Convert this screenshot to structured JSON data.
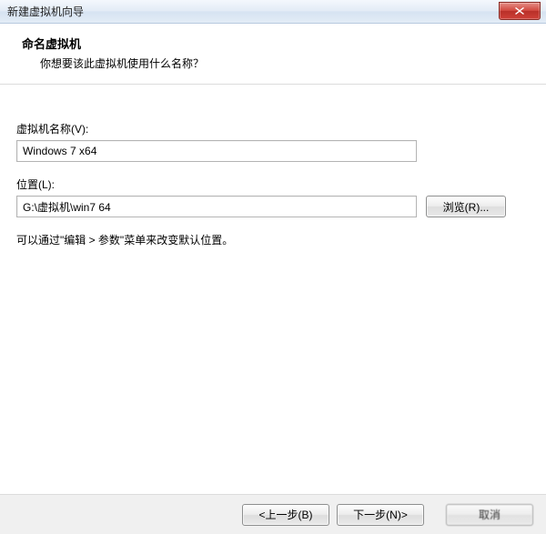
{
  "window": {
    "title": "新建虚拟机向导"
  },
  "header": {
    "title": "命名虚拟机",
    "subtitle": "你想要该此虚拟机使用什么名称？"
  },
  "vm_name": {
    "label": "虚拟机名称(V):",
    "value": "Windows 7 x64"
  },
  "location": {
    "label": "位置(L):",
    "value": "G:\\虚拟机\\win7 64",
    "browse_label": "浏览(R)..."
  },
  "hint": "可以通过\"编辑 > 参数\"菜单来改变默认位置。",
  "footer": {
    "back_label": "<上一步(B)",
    "next_label": "下一步(N)>",
    "cancel_label": "取消"
  }
}
